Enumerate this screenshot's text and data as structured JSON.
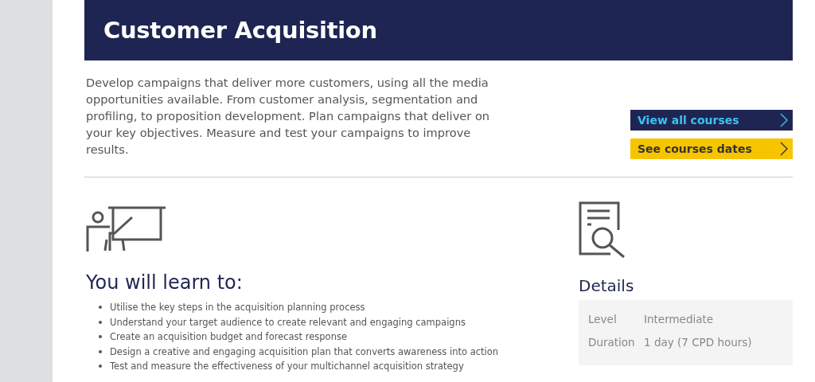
{
  "header": {
    "title": "Customer Acquisition"
  },
  "intro": "Develop campaigns that deliver more customers, using all the media opportunities available. From customer analysis, segmentation and profiling, to proposition development. Plan campaigns that deliver on your key objectives. Measure and test your campaigns to improve results.",
  "buttons": [
    {
      "label": "View all courses",
      "kind": "primary"
    },
    {
      "label": "See courses dates",
      "kind": "secondary"
    }
  ],
  "learn": {
    "heading": "You will learn to:",
    "items": [
      "Utilise the key steps in the acquisition planning process",
      "Understand your target audience to create relevant and engaging campaigns",
      "Create an acquisition budget and forecast response",
      "Design a creative and engaging acquisition plan that converts awareness into action",
      "Test and measure the effectiveness of your multichannel acquisition strategy"
    ]
  },
  "details": {
    "heading": "Details",
    "rows": [
      {
        "label": "Level",
        "value": "Intermediate"
      },
      {
        "label": "Duration",
        "value": "1 day (7 CPD hours)"
      }
    ]
  }
}
